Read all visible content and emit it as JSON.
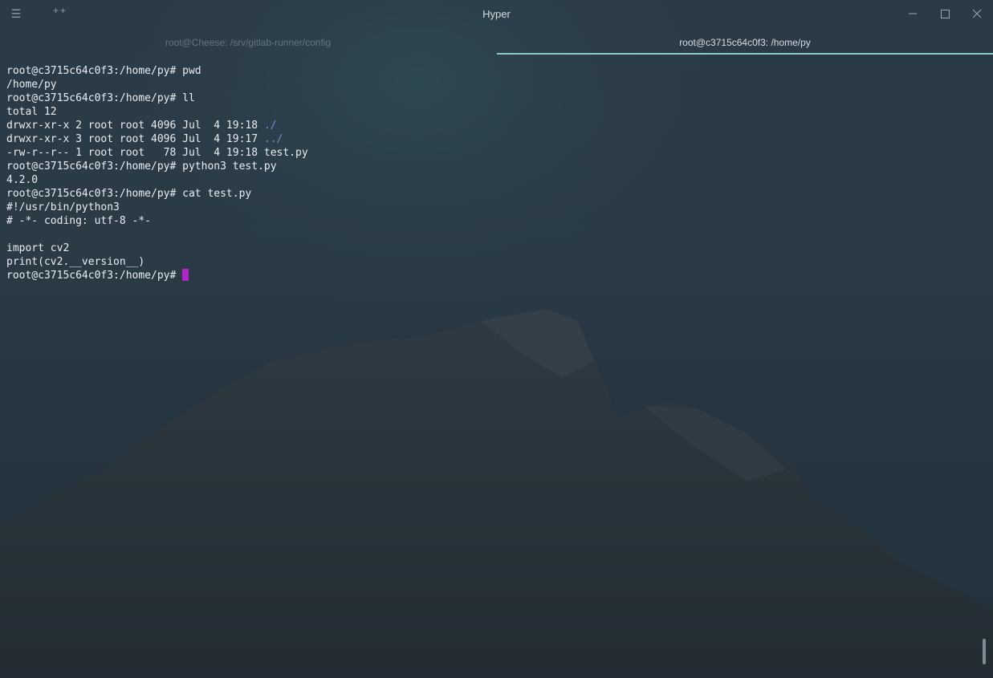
{
  "window": {
    "title": "Hyper",
    "menu_icon": "hamburger-icon",
    "new_tab_glyph": "++",
    "controls": [
      "minimize-icon",
      "maximize-icon",
      "close-icon"
    ]
  },
  "tabs": [
    {
      "label": "root@Cheese: /srv/gitlab-runner/config",
      "active": false
    },
    {
      "label": "root@c3715c64c0f3: /home/py",
      "active": true
    }
  ],
  "terminal": {
    "lines": [
      {
        "parts": [
          {
            "text": "root@c3715c64c0f3:/home/py# pwd"
          }
        ]
      },
      {
        "parts": [
          {
            "text": "/home/py"
          }
        ]
      },
      {
        "parts": [
          {
            "text": "root@c3715c64c0f3:/home/py# ll"
          }
        ]
      },
      {
        "parts": [
          {
            "text": "total 12"
          }
        ]
      },
      {
        "parts": [
          {
            "text": "drwxr-xr-x 2 root root 4096 Jul  4 19:18 "
          },
          {
            "text": "./",
            "style": "dir"
          }
        ]
      },
      {
        "parts": [
          {
            "text": "drwxr-xr-x 3 root root 4096 Jul  4 19:17 "
          },
          {
            "text": "../",
            "style": "dir"
          }
        ]
      },
      {
        "parts": [
          {
            "text": "-rw-r--r-- 1 root root   78 Jul  4 19:18 test.py"
          }
        ]
      },
      {
        "parts": [
          {
            "text": "root@c3715c64c0f3:/home/py# python3 test.py"
          }
        ]
      },
      {
        "parts": [
          {
            "text": "4.2.0"
          }
        ]
      },
      {
        "parts": [
          {
            "text": "root@c3715c64c0f3:/home/py# cat test.py"
          }
        ]
      },
      {
        "parts": [
          {
            "text": "#!/usr/bin/python3"
          }
        ]
      },
      {
        "parts": [
          {
            "text": "# -*- coding: utf-8 -*-"
          }
        ]
      },
      {
        "parts": [
          {
            "text": ""
          }
        ]
      },
      {
        "parts": [
          {
            "text": "import cv2"
          }
        ]
      },
      {
        "parts": [
          {
            "text": "print(cv2.__version__)"
          }
        ]
      },
      {
        "parts": [
          {
            "text": "root@c3715c64c0f3:/home/py# "
          }
        ],
        "cursor": true
      }
    ]
  },
  "colors": {
    "accent_tab_underline": "#8ec9c9",
    "cursor": "#b026c8",
    "directory": "#6c8fd8",
    "text": "#e9eef2"
  }
}
